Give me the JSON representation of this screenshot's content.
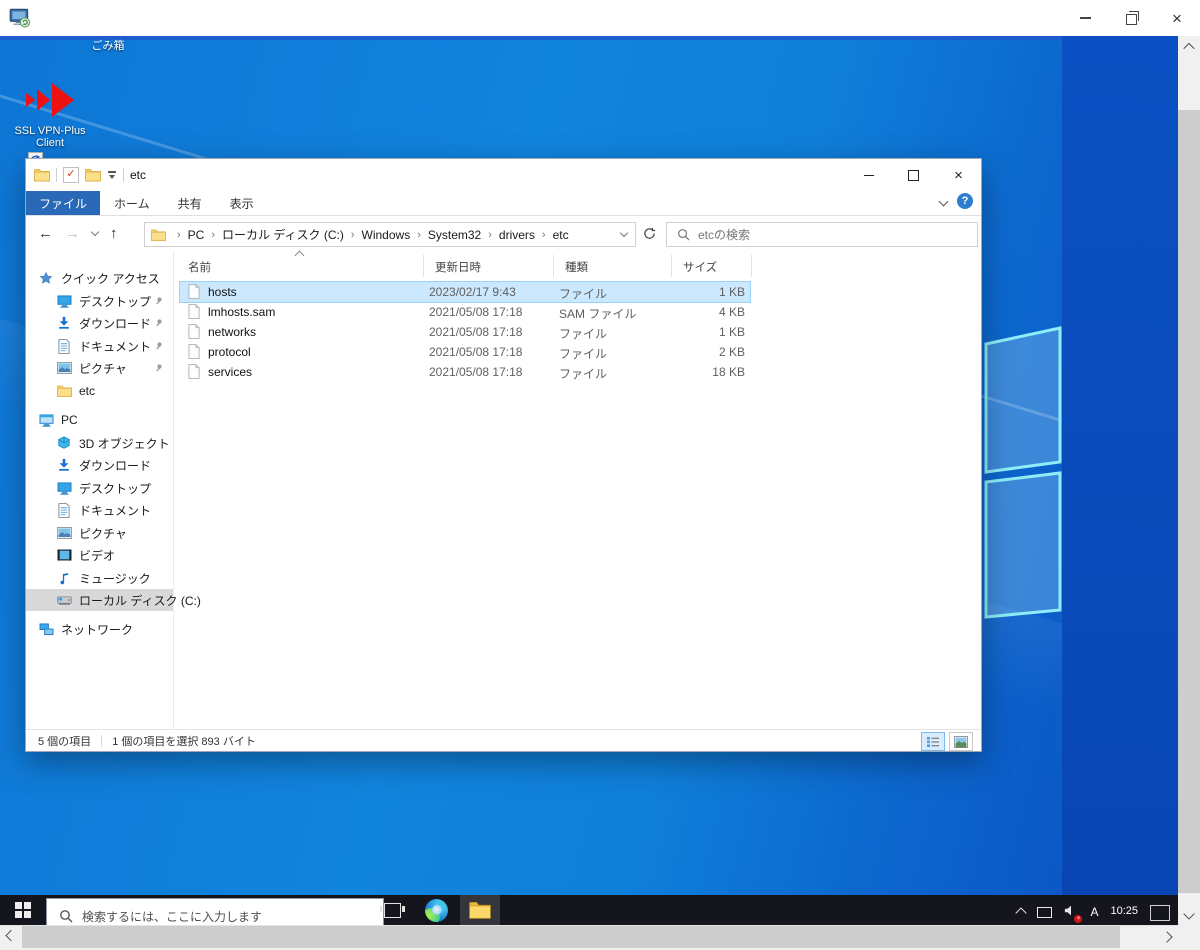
{
  "desktop": {
    "recycle_bin": "ごみ箱",
    "vpn_line1": "SSL VPN-Plus",
    "vpn_line2": "Client"
  },
  "explorer": {
    "window_title": "etc",
    "tabs": {
      "file": "ファイル",
      "home": "ホーム",
      "share": "共有",
      "view": "表示"
    },
    "breadcrumb": [
      "PC",
      "ローカル ディスク (C:)",
      "Windows",
      "System32",
      "drivers",
      "etc"
    ],
    "search_placeholder": "etcの検索",
    "sidebar": {
      "quick_access": "クイック アクセス",
      "qa_items": [
        {
          "label": "デスクトップ"
        },
        {
          "label": "ダウンロード"
        },
        {
          "label": "ドキュメント"
        },
        {
          "label": "ピクチャ"
        },
        {
          "label": "etc"
        }
      ],
      "pc": "PC",
      "pc_items": [
        {
          "label": "3D オブジェクト"
        },
        {
          "label": "ダウンロード"
        },
        {
          "label": "デスクトップ"
        },
        {
          "label": "ドキュメント"
        },
        {
          "label": "ピクチャ"
        },
        {
          "label": "ビデオ"
        },
        {
          "label": "ミュージック"
        },
        {
          "label": "ローカル ディスク (C:)"
        }
      ],
      "network": "ネットワーク"
    },
    "columns": {
      "name": "名前",
      "date": "更新日時",
      "type": "種類",
      "size": "サイズ"
    },
    "files": [
      {
        "name": "hosts",
        "date": "2023/02/17 9:43",
        "type": "ファイル",
        "size": "1 KB"
      },
      {
        "name": "lmhosts.sam",
        "date": "2021/05/08 17:18",
        "type": "SAM ファイル",
        "size": "4 KB"
      },
      {
        "name": "networks",
        "date": "2021/05/08 17:18",
        "type": "ファイル",
        "size": "1 KB"
      },
      {
        "name": "protocol",
        "date": "2021/05/08 17:18",
        "type": "ファイル",
        "size": "2 KB"
      },
      {
        "name": "services",
        "date": "2021/05/08 17:18",
        "type": "ファイル",
        "size": "18 KB"
      }
    ],
    "status": {
      "count": "5 個の項目",
      "selection": "1 個の項目を選択 893 バイト"
    }
  },
  "taskbar": {
    "search_placeholder": "検索するには、ここに入力します",
    "ime_mode": "A",
    "time": "10:25"
  },
  "colors": {
    "accent": "#0f7fda",
    "wallpaper_dark": "#0a50c2",
    "selection": "#cce8ff",
    "file_tab": "#2a69b8",
    "taskbar": "#14151d",
    "vpn_red": "#ee1111"
  }
}
